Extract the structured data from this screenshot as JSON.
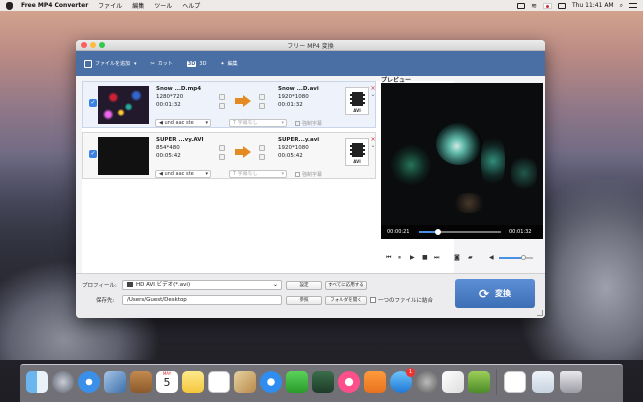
{
  "menubar": {
    "app": "Free MP4 Converter",
    "items": [
      "ファイル",
      "編集",
      "ツール",
      "ヘルプ"
    ],
    "clock": "Thu 11:41 AM"
  },
  "window": {
    "title": "フリー MP4 変換"
  },
  "toolbar": {
    "add_file": "ファイルを追加",
    "cut": "カット",
    "3d_badge": "3D",
    "3d": "3D",
    "edit": "編集"
  },
  "files": [
    {
      "src_name": "Snow ...D.mp4",
      "src_res": "1280*720",
      "src_dur": "00:01:32",
      "out_name": "Snow ...D.avi",
      "out_res": "1920*1080",
      "out_dur": "00:01:32",
      "audio": "und aac ste",
      "subtitle": "字幕なし",
      "forced": "強制字幕",
      "format": "AVI"
    },
    {
      "src_name": "SUPER ...vy.AVI",
      "src_res": "854*480",
      "src_dur": "00:05:42",
      "out_name": "SUPER...y.avi",
      "out_res": "1920*1080",
      "out_dur": "00:05:42",
      "audio": "und aac ste",
      "subtitle": "字幕なし",
      "forced": "強制字幕",
      "format": "AVI"
    }
  ],
  "preview": {
    "label": "プレビュー",
    "time_current": "00:00:21",
    "time_total": "00:01:32",
    "progress": 0.23,
    "volume": 0.72
  },
  "bottom": {
    "profile_label": "プロフィール:",
    "profile_value": "HD AVI ビデオ(*.avi)",
    "settings": "設定",
    "apply_all": "すべてに応用する",
    "dest_label": "保存先:",
    "dest_value": "/Users/Guest/Desktop",
    "browse": "参照",
    "open_folder": "フォルダを開く",
    "merge": "一つのファイルに結合",
    "convert": "変換"
  },
  "dock": {
    "calendar_month": "MAY",
    "calendar_day": "5",
    "app_store_badge": "1"
  }
}
